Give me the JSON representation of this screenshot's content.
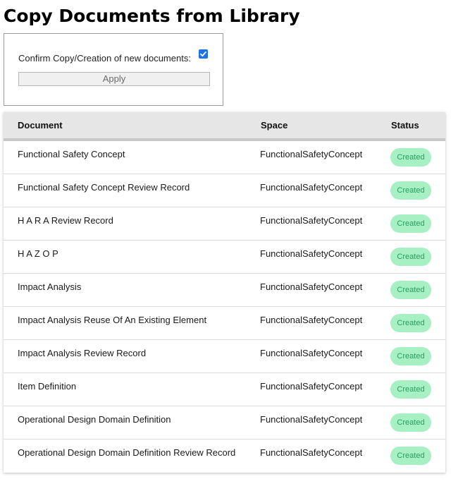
{
  "page": {
    "title": "Copy Documents from Library"
  },
  "confirm": {
    "label": "Confirm Copy/Creation of new documents:",
    "checked": true,
    "apply_label": "Apply"
  },
  "table": {
    "headers": {
      "document": "Document",
      "space": "Space",
      "status": "Status"
    },
    "rows": [
      {
        "document": "Functional Safety Concept",
        "space": "FunctionalSafetyConcept",
        "status": "Created"
      },
      {
        "document": "Functional Safety Concept Review Record",
        "space": "FunctionalSafetyConcept",
        "status": "Created"
      },
      {
        "document": "H A R A Review Record",
        "space": "FunctionalSafetyConcept",
        "status": "Created"
      },
      {
        "document": "H A Z O P",
        "space": "FunctionalSafetyConcept",
        "status": "Created"
      },
      {
        "document": "Impact Analysis",
        "space": "FunctionalSafetyConcept",
        "status": "Created"
      },
      {
        "document": "Impact Analysis Reuse Of An Existing Element",
        "space": "FunctionalSafetyConcept",
        "status": "Created"
      },
      {
        "document": "Impact Analysis Review Record",
        "space": "FunctionalSafetyConcept",
        "status": "Created"
      },
      {
        "document": "Item Definition",
        "space": "FunctionalSafetyConcept",
        "status": "Created"
      },
      {
        "document": "Operational Design Domain Definition",
        "space": "FunctionalSafetyConcept",
        "status": "Created"
      },
      {
        "document": "Operational Design Domain Definition Review Record",
        "space": "FunctionalSafetyConcept",
        "status": "Created"
      }
    ]
  },
  "colors": {
    "checkbox": "#1a73e8",
    "badge_bg": "#a7f0c4",
    "badge_text": "#2a9d5c",
    "header_bg": "#e6e6e6"
  },
  "icons": {
    "checkbox": "checkmark-icon"
  }
}
